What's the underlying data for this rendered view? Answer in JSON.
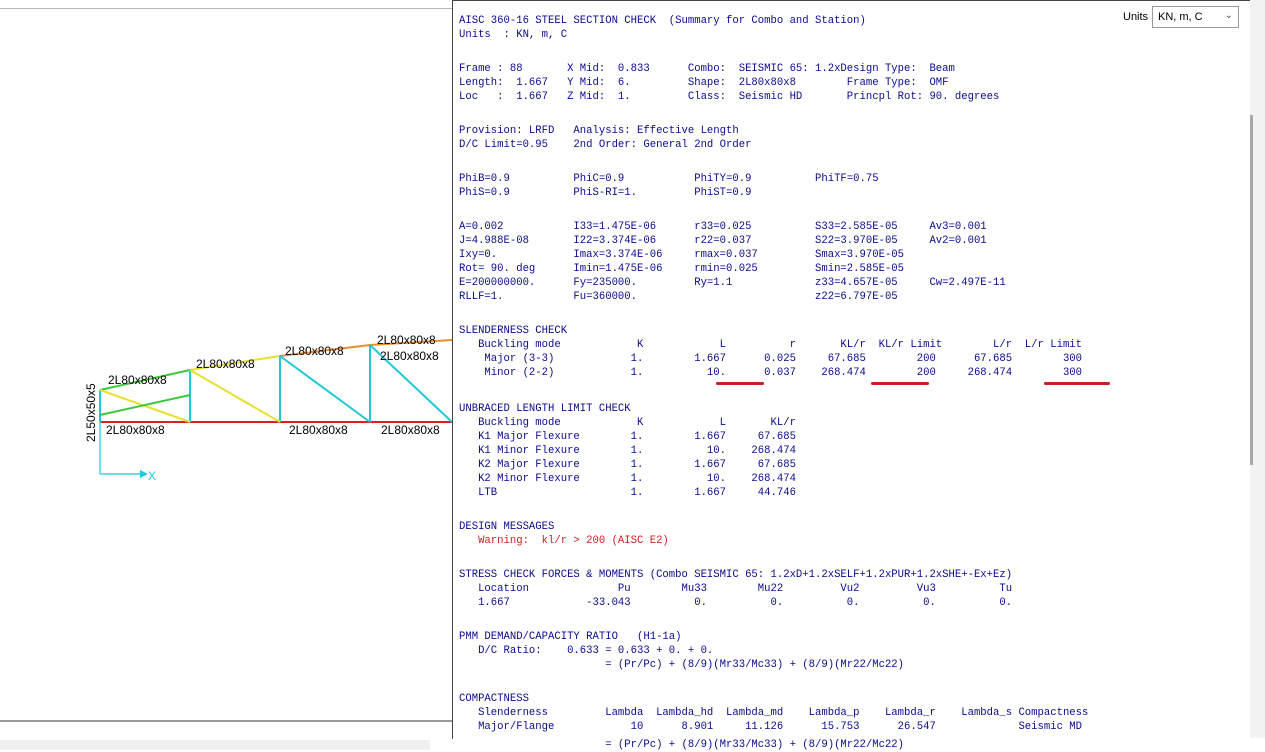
{
  "model": {
    "members": [
      {
        "label": "2L80x80x8",
        "color": "#000000"
      },
      {
        "label": "2L50x50x5",
        "color": "#000000"
      }
    ],
    "labels": {
      "top_right": "2L80x80x8",
      "top_right2": "2L80x80x8",
      "top_mid": "2L80x80x8",
      "top_left": "2L80x80x8",
      "top_left2": "2L80x80x8",
      "bottom_a": "2L80x80x8",
      "bottom_b": "2L80x80x8",
      "bottom_c": "2L80x80x8",
      "vertical_left": "2L50x50x5",
      "axis_x": "X"
    },
    "axis_color": "#1ec8d8",
    "highlight_color": "#e02020"
  },
  "header": {
    "title_line": "AISC 360-16 STEEL SECTION CHECK  (Summary for Combo and Station)",
    "units_line": "Units  : KN, m, C",
    "units_label": "Units",
    "units_value": "KN, m, C"
  },
  "report_lines": {
    "l1": "Frame : 88       X Mid:  0.833      Combo:  SEISMIC 65: 1.2xDesign Type:  Beam",
    "l2": "Length:  1.667   Y Mid:  6.         Shape:  2L80x80x8        Frame Type:  OMF",
    "l3": "Loc   :  1.667   Z Mid:  1.         Class:  Seismic HD       Princpl Rot: 90. degrees",
    "l4": "Provision: LRFD   Analysis: Effective Length",
    "l5": "D/C Limit=0.95    2nd Order: General 2nd Order",
    "l6": "PhiB=0.9          PhiC=0.9           PhiTY=0.9          PhiTF=0.75",
    "l7": "PhiS=0.9          PhiS-RI=1.         PhiST=0.9",
    "l8": "A=0.002           I33=1.475E-06      r33=0.025          S33=2.585E-05     Av3=0.001",
    "l9": "J=4.988E-08       I22=3.374E-06      r22=0.037          S22=3.970E-05     Av2=0.001",
    "l10": "Ixy=0.            Imax=3.374E-06     rmax=0.037         Smax=3.970E-05",
    "l11": "Rot= 90. deg      Imin=1.475E-06     rmin=0.025         Smin=2.585E-05",
    "l12": "E=200000000.      Fy=235000.         Ry=1.1             z33=4.657E-05     Cw=2.497E-11",
    "l13": "RLLF=1.           Fu=360000.                            z22=6.797E-05",
    "l14": "SLENDERNESS CHECK",
    "l15": "   Buckling mode            K            L          r       KL/r  KL/r Limit        L/r  L/r Limit",
    "l16": "    Major (3-3)            1.        1.667      0.025     67.685        200      67.685        300",
    "l17": "    Minor (2-2)            1.          10.      0.037    268.474        200     268.474        300",
    "l18": "UNBRACED LENGTH LIMIT CHECK",
    "l19": "   Buckling mode            K            L       KL/r",
    "l20": "   K1 Major Flexure        1.        1.667     67.685",
    "l21": "   K1 Minor Flexure        1.          10.    268.474",
    "l22": "   K2 Major Flexure        1.        1.667     67.685",
    "l23": "   K2 Minor Flexure        1.          10.    268.474",
    "l24": "   LTB                     1.        1.667     44.746",
    "l25": "DESIGN MESSAGES",
    "l26": "   Warning:  kl/r > 200 (AISC E2)",
    "l27": "STRESS CHECK FORCES & MOMENTS (Combo SEISMIC 65: 1.2xD+1.2xSELF+1.2xPUR+1.2xSHE+-Ex+Ez)",
    "l28": "   Location              Pu        Mu33        Mu22         Vu2         Vu3          Tu",
    "l29": "   1.667            -33.043          0.          0.          0.          0.          0.",
    "l30": "PMM DEMAND/CAPACITY RATIO   (H1-1a)",
    "l31": "   D/C Ratio:    0.633 = 0.633 + 0. + 0.",
    "l32": "                       = (Pr/Pc) + (8/9)(Mr33/Mc33) + (8/9)(Mr22/Mc22)",
    "l33": "COMPACTNESS",
    "l34": "   Slenderness         Lambda  Lambda_hd  Lambda_md    Lambda_p    Lambda_r    Lambda_s Compactness",
    "l35": "   Major/Flange            10      8.901     11.126      15.753      26.547             Seismic MD",
    "l36": "                       = (Pr/Pc) + (8/9)(Mr33/Mc33) + (8/9)(Mr22/Mc22)"
  },
  "colors": {
    "report_text": "#0b0b8e",
    "warning_text": "#cc1f1f",
    "underline_marks": "#cc1f1f"
  }
}
